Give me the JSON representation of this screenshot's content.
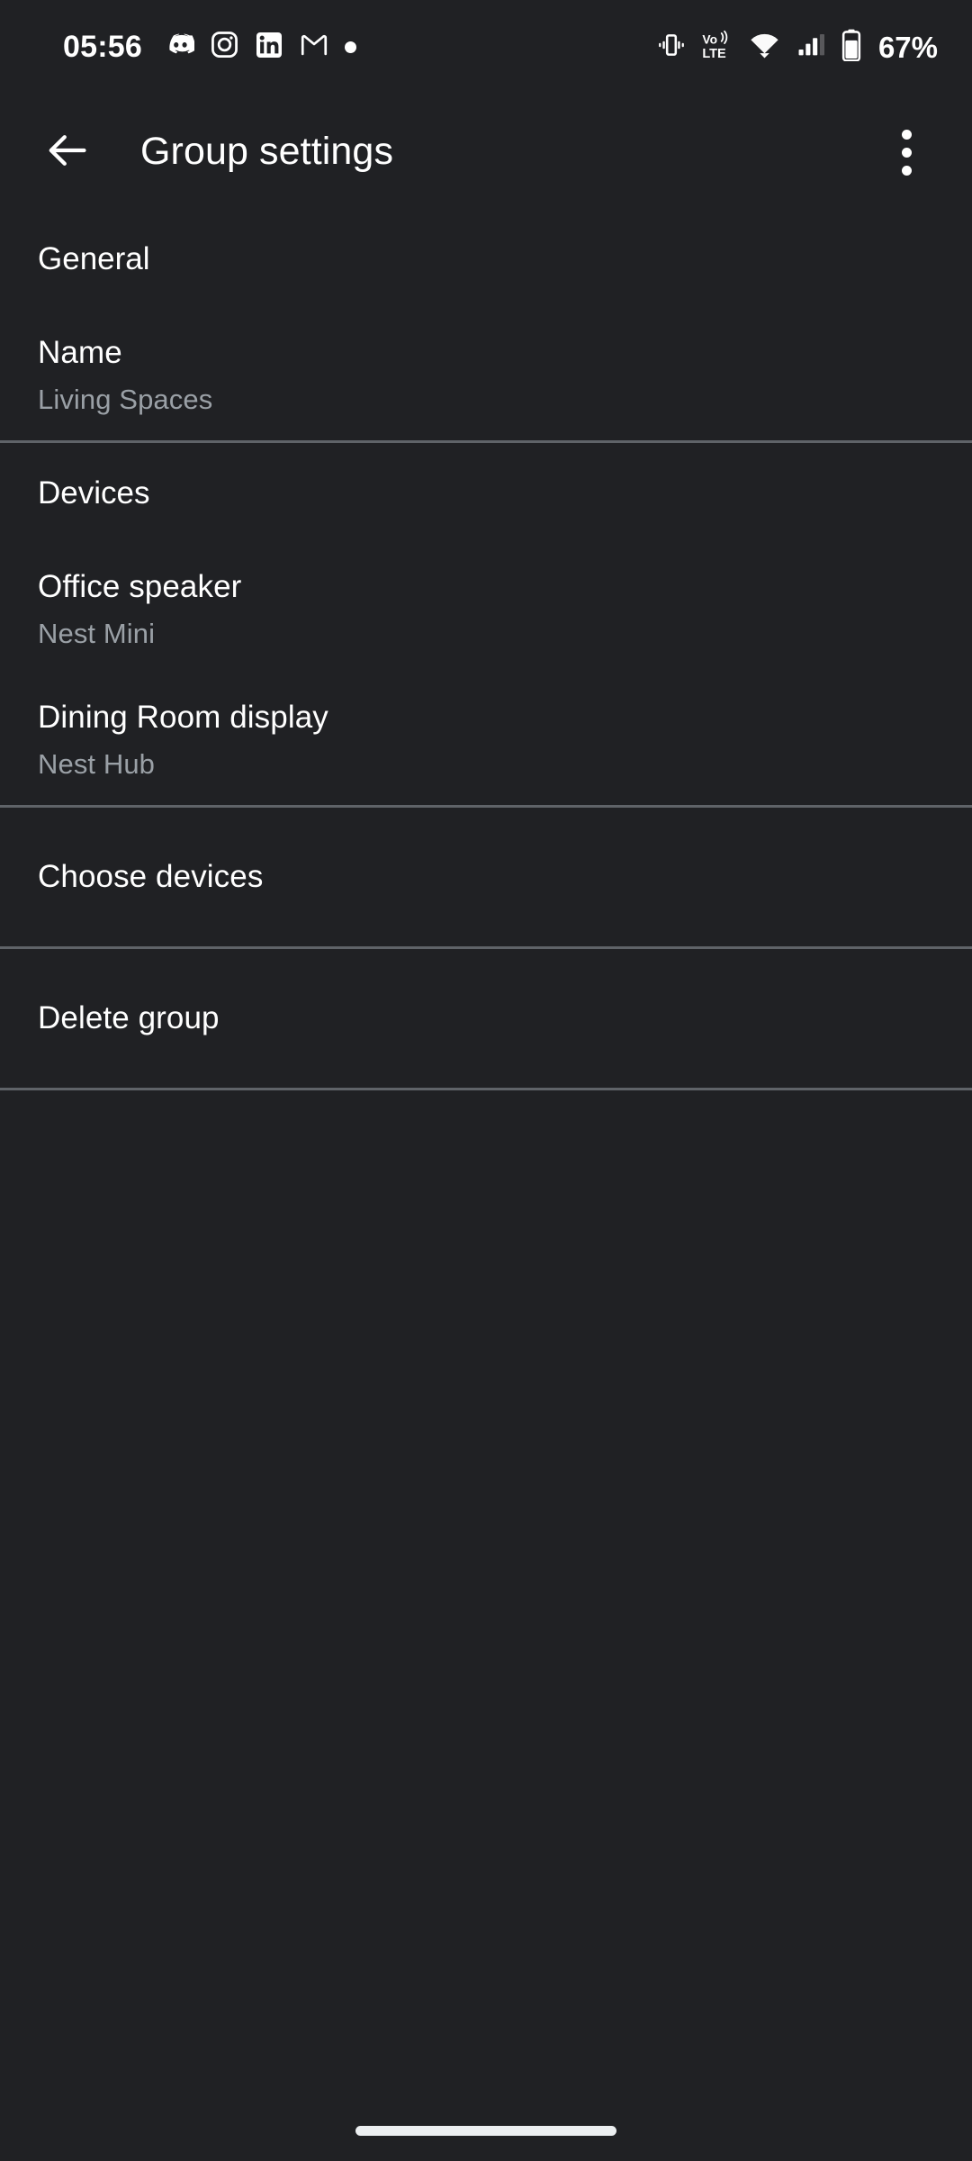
{
  "status_bar": {
    "time": "05:56",
    "battery_percent": "67%",
    "notification_icons": [
      {
        "name": "discord-icon",
        "label": "Discord"
      },
      {
        "name": "instagram-icon",
        "label": "Instagram"
      },
      {
        "name": "linkedin-icon",
        "label": "LinkedIn"
      },
      {
        "name": "gmail-icon",
        "label": "Gmail"
      },
      {
        "name": "more-notifications-dot-icon",
        "label": "More notifications"
      }
    ],
    "system_icons": [
      {
        "name": "vibrate-mode-icon",
        "label": "Vibrate"
      },
      {
        "name": "volte-icon",
        "label": "VoLTE"
      },
      {
        "name": "wifi-icon",
        "label": "Wi-Fi"
      },
      {
        "name": "cellular-signal-icon",
        "label": "Signal"
      },
      {
        "name": "battery-icon",
        "label": "Battery"
      }
    ]
  },
  "app_bar": {
    "title": "Group settings",
    "back_label": "Navigate up",
    "overflow_label": "More options"
  },
  "sections": {
    "general": {
      "header": "General",
      "name_row": {
        "title": "Name",
        "subtitle": "Living Spaces"
      }
    },
    "devices": {
      "header": "Devices",
      "items": [
        {
          "title": "Office speaker",
          "subtitle": "Nest Mini"
        },
        {
          "title": "Dining Room display",
          "subtitle": "Nest Hub"
        }
      ]
    },
    "actions": [
      {
        "label": "Choose devices"
      },
      {
        "label": "Delete group"
      }
    ]
  },
  "colors": {
    "background": "#202124",
    "primary_text": "#ffffff",
    "secondary_text": "#9aa0a6",
    "divider": "#5f6368",
    "gesture_bar": "#eceff1"
  }
}
